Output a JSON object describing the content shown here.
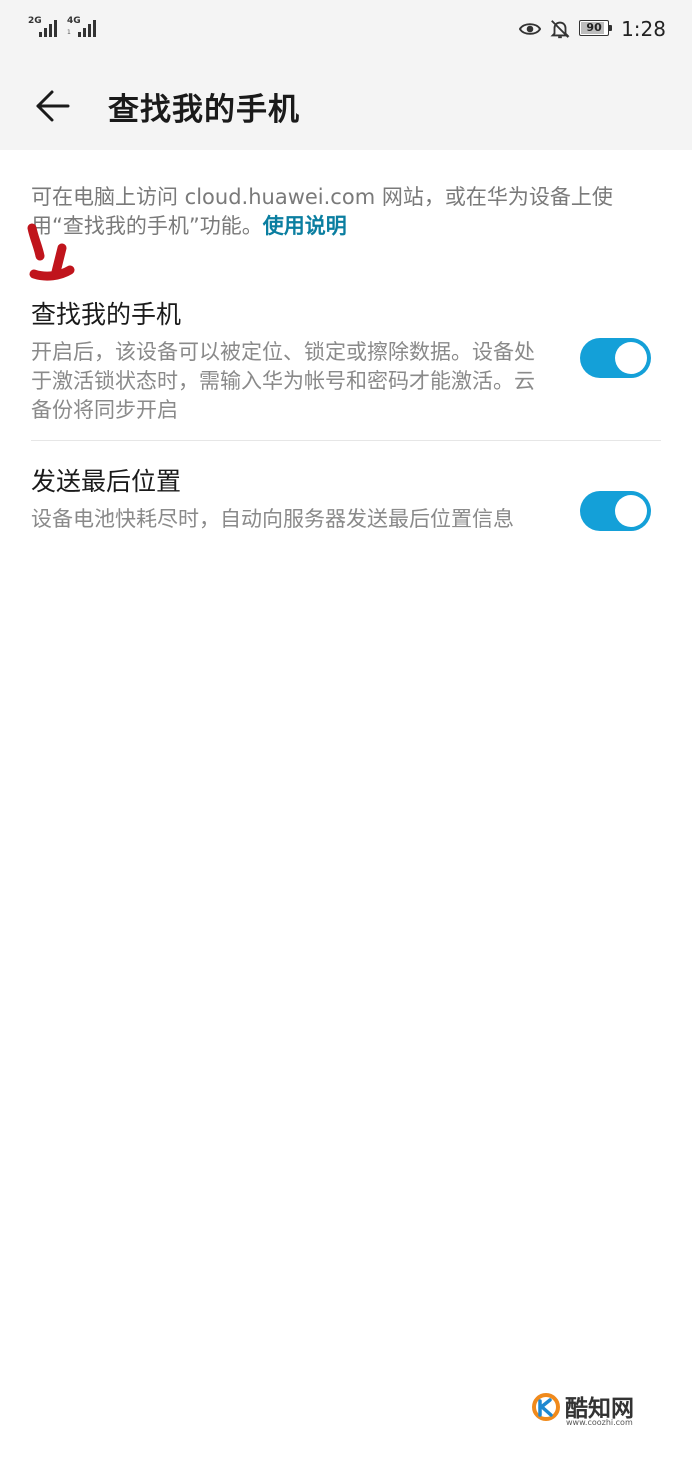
{
  "status_bar": {
    "signal_1": "2G",
    "signal_2": "4G",
    "signal_2_sub": "1",
    "battery": "90",
    "time": "1:28"
  },
  "header": {
    "title": "查找我的手机",
    "back_icon": "arrow-left-icon"
  },
  "intro": {
    "text": "可在电脑上访问 cloud.huawei.com 网站，或在华为设备上使用“查找我的手机”功能。",
    "link": "使用说明"
  },
  "settings": [
    {
      "title": "查找我的手机",
      "description": "开启后，该设备可以被定位、锁定或擦除数据。设备处于激活锁状态时，需输入华为帐号和密码才能激活。云备份将同步开启",
      "enabled": true
    },
    {
      "title": "发送最后位置",
      "description": "设备电池快耗尽时，自动向服务器发送最后位置信息",
      "enabled": true
    }
  ],
  "colors": {
    "toggle_on": "#14a0d8",
    "link": "#0a7ea0",
    "annotation": "#c0141c"
  },
  "watermark": {
    "name": "酷知网",
    "url": "www.coozhi.com"
  }
}
